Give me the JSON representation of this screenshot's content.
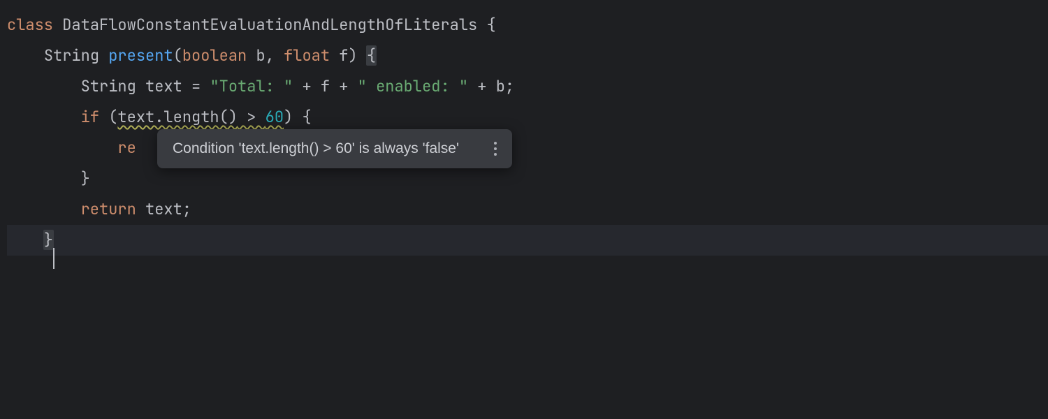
{
  "code": {
    "line1": {
      "kw_class": "class",
      "class_name": "DataFlowConstantEvaluationAndLengthOfLiterals",
      "brace_open": "{"
    },
    "line2": {
      "ret_type": "String",
      "method_name": "present",
      "paren_open": "(",
      "p1_type": "boolean",
      "p1_name": "b",
      "comma": ",",
      "p2_type": "float",
      "p2_name": "f",
      "paren_close": ")",
      "brace_open": "{"
    },
    "line3": {
      "type": "String",
      "var": "text",
      "eq": "=",
      "str1": "\"Total: \"",
      "plus1": "+",
      "f": "f",
      "plus2": "+",
      "str2": "\" enabled: \"",
      "plus3": "+",
      "b": "b",
      "semi": ";"
    },
    "line4": {
      "kw_if": "if",
      "paren_open": "(",
      "cond_left": "text.length()",
      "cond_op_space": " > ",
      "cond_right": "60",
      "paren_close": ")",
      "brace_open": "{"
    },
    "line5": {
      "partial_return": "re"
    },
    "line6": {
      "brace_close": "}"
    },
    "line7": {
      "kw_return": "return",
      "var": "text",
      "semi": ";"
    },
    "line8": {
      "brace_close": "}"
    }
  },
  "tooltip": {
    "message": "Condition 'text.length() > 60' is always 'false'"
  }
}
